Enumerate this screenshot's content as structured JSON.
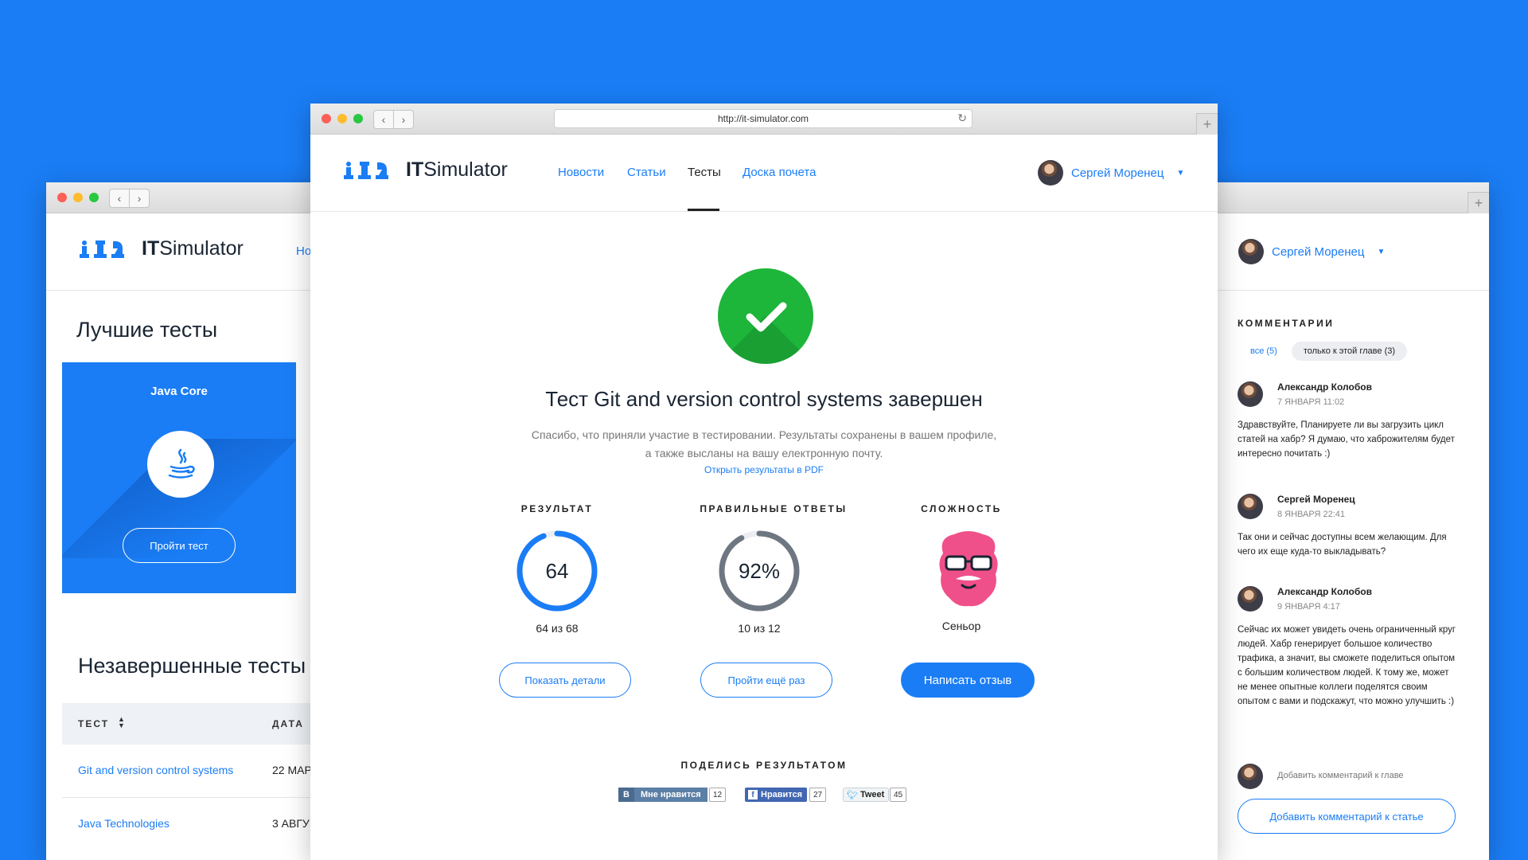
{
  "brand": {
    "name_bold": "IT",
    "name_rest": "Simulator"
  },
  "back_window": {
    "nav_partial": "Но",
    "best_tests_title": "Лучшие тесты",
    "card": {
      "title": "Java Core",
      "button": "Пройти тест"
    },
    "unfinished_title": "Незавершенные тесты",
    "table": {
      "headers": [
        "ТЕСТ",
        "ДАТА"
      ],
      "rows": [
        {
          "name": "Git and version control systems",
          "date": "22 МАР"
        },
        {
          "name": "Java Technologies",
          "date": "3 АВГУ"
        }
      ]
    },
    "user_name": "Сергей Моренец",
    "comments": {
      "title": "КОММЕНТАРИИ",
      "filter_all": "все (5)",
      "filter_chapter": "только к этой главе (3)",
      "items": [
        {
          "author": "Александр Колобов",
          "date": "7 ЯНВАРЯ 11:02",
          "text": "Здравствуйте, Планируете ли вы загрузить цикл статей на хабр? Я думаю, что хаброжителям будет интересно почитать :)"
        },
        {
          "author": "Сергей Моренец",
          "date": "8 ЯНВАРЯ 22:41",
          "text": "Так они и сейчас доступны всем желающим. Для чего их еще куда-то выкладывать?"
        },
        {
          "author": "Александр Колобов",
          "date": "9 ЯНВАРЯ 4:17",
          "text": "Сейчас их может увидеть очень ограниченный круг людей. Хабр генерирует большое количество трафика, а значит, вы сможете поделиться опытом с большим количеством людей. К тому же, может не менее опытные коллеги поделятся своим опытом с вами и подскажут, что можно улучшить :)"
        }
      ],
      "add_placeholder": "Добавить комментарий к главе",
      "add_article_button": "Добавить комментарий к статье"
    }
  },
  "front_window": {
    "url": "http://it-simulator.com",
    "nav": [
      "Новости",
      "Статьи",
      "Тесты",
      "Доска почета"
    ],
    "active_nav": 2,
    "user_name": "Сергей Моренец",
    "result_title": "Тест Git and version control systems завершен",
    "result_text_line1": "Спасибо, что приняли участие в тестировании. Результаты сохранены в вашем профиле,",
    "result_text_line2": "а также высланы на вашу електронную почту.",
    "pdf_link": "Открыть результаты в PDF",
    "stats": [
      {
        "title": "РЕЗУЛЬТАТ",
        "value": "64",
        "sub": "64 из 68",
        "fraction": 0.94,
        "color": "#1a7df5"
      },
      {
        "title": "ПРАВИЛЬНЫЕ ОТВЕТЫ",
        "value": "92%",
        "sub": "10 из 12",
        "fraction": 0.92,
        "color": "#6e7781"
      },
      {
        "title": "СЛОЖНОСТЬ",
        "sub": "Сеньор"
      }
    ],
    "buttons": {
      "details": "Показать детали",
      "retry": "Пройти ещё раз",
      "review": "Написать отзыв"
    },
    "share": {
      "title": "ПОДЕЛИСЬ РЕЗУЛЬТАТОМ",
      "vk_label": "Мне нравится",
      "vk_count": "12",
      "fb_label": "Нравится",
      "fb_count": "27",
      "tw_label": "Tweet",
      "tw_count": "45"
    }
  },
  "colors": {
    "accent": "#1a7df5",
    "success": "#1db53a",
    "senior": "#f0508a",
    "background": "#1a7df5"
  }
}
